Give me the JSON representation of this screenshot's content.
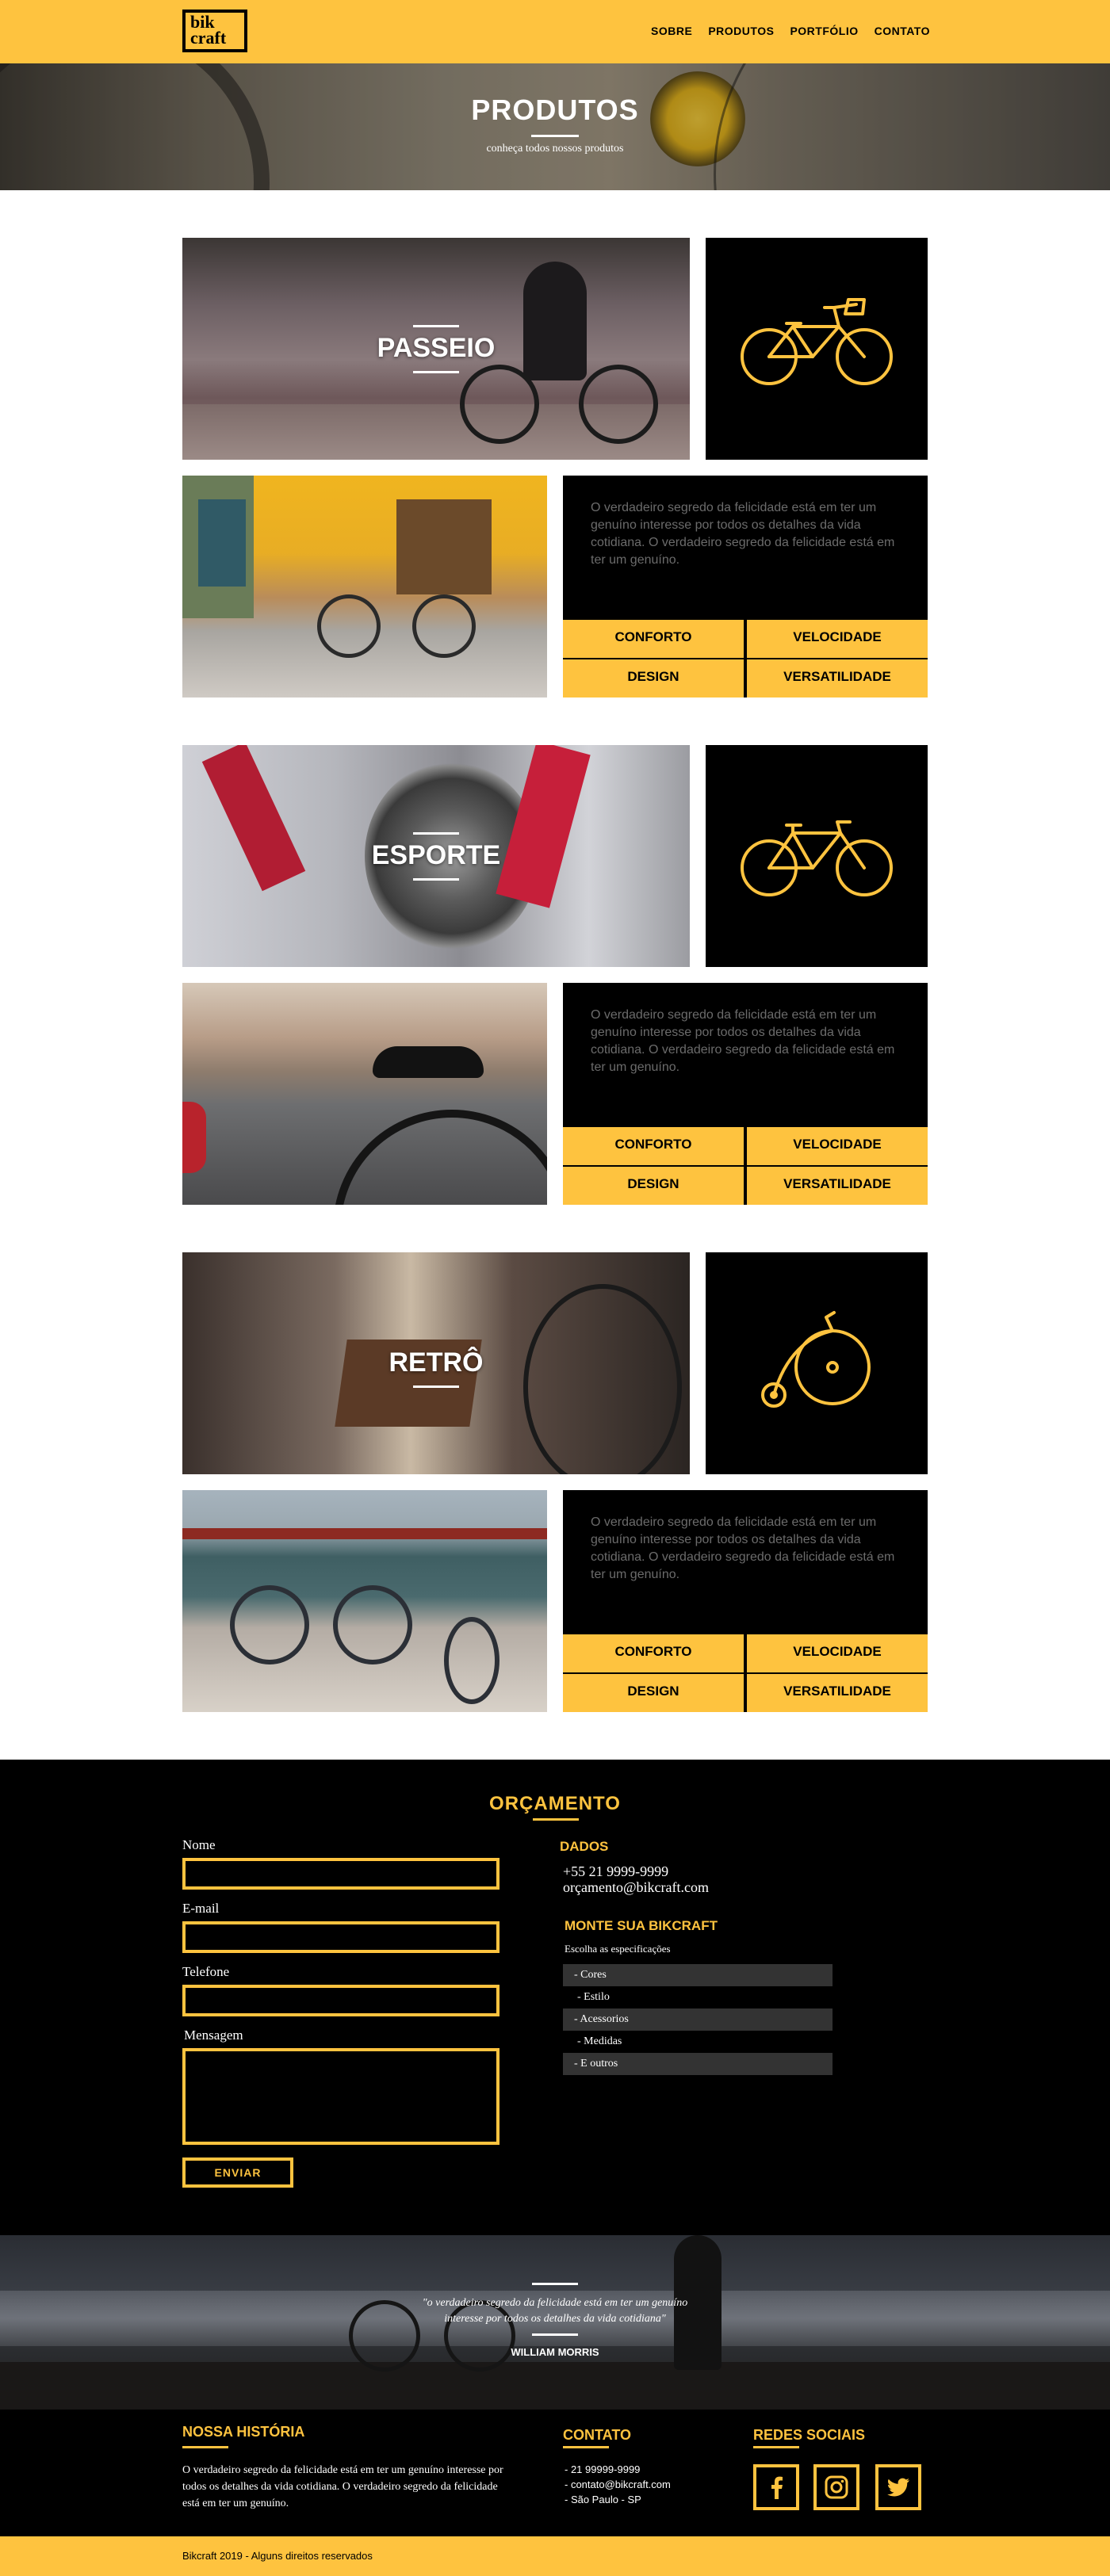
{
  "header": {
    "logo_line1": "bik",
    "logo_line2": "craft",
    "nav": [
      "SOBRE",
      "PRODUTOS",
      "PORTFÓLIO",
      "CONTATO"
    ]
  },
  "hero": {
    "title": "PRODUTOS",
    "subtitle": "conheça todos nossos produtos"
  },
  "products": [
    {
      "title": "PASSEIO",
      "icon": "city-bike-icon",
      "description": "O verdadeiro segredo da felicidade está em ter um genuíno interesse por todos os detalhes da vida cotidiana. O verdadeiro segredo da felicidade está em ter um genuíno.",
      "features": [
        "CONFORTO",
        "VELOCIDADE",
        "DESIGN",
        "VERSATILIDADE"
      ]
    },
    {
      "title": "ESPORTE",
      "icon": "sport-bike-icon",
      "description": "O verdadeiro segredo da felicidade está em ter um genuíno interesse por todos os detalhes da vida cotidiana. O verdadeiro segredo da felicidade está em ter um genuíno.",
      "features": [
        "CONFORTO",
        "VELOCIDADE",
        "DESIGN",
        "VERSATILIDADE"
      ]
    },
    {
      "title": "RETRÔ",
      "icon": "penny-farthing-icon",
      "description": "O verdadeiro segredo da felicidade está em ter um genuíno interesse por todos os detalhes da vida cotidiana. O verdadeiro segredo da felicidade está em ter um genuíno.",
      "features": [
        "CONFORTO",
        "VELOCIDADE",
        "DESIGN",
        "VERSATILIDADE"
      ]
    }
  ],
  "budget": {
    "title": "ORÇAMENTO",
    "labels": {
      "nome": "Nome",
      "email": "E-mail",
      "telefone": "Telefone",
      "mensagem": "Mensagem"
    },
    "submit": "ENVIAR",
    "dados_title": "DADOS",
    "phone": "+55 21 9999-9999",
    "email": "orçamento@bikcraft.com",
    "monte_title": "MONTE SUA BIKCRAFT",
    "monte_sub": "Escolha as especificações",
    "options": [
      "- Cores",
      "- Estilo",
      "- Acessorios",
      "- Medidas",
      "- E outros"
    ]
  },
  "quote": {
    "text_line1": "\"o verdadeiro segredo da felicidade está em ter um genuíno",
    "text_line2": "interesse por todos os detalhes da vida cotidiana\"",
    "author": "WILLIAM MORRIS"
  },
  "footer": {
    "historia_title": "NOSSA HISTÓRIA",
    "historia_text": "O verdadeiro segredo da felicidade está em ter um genuíno interesse por todos os detalhes da vida cotidiana. O verdadeiro segredo da felicidade está em ter um genuíno.",
    "contato_title": "CONTATO",
    "contato": [
      "- 21 99999-9999",
      "- contato@bikcraft.com",
      "- São Paulo - SP"
    ],
    "redes_title": "REDES SOCIAIS",
    "social_icons": [
      "facebook-icon",
      "instagram-icon",
      "twitter-icon"
    ],
    "copyright": "Bikcraft 2019 - Alguns direitos reservados"
  },
  "colors": {
    "accent": "#fec33f",
    "dark": "#000000",
    "text_muted": "#6b6b6b"
  }
}
